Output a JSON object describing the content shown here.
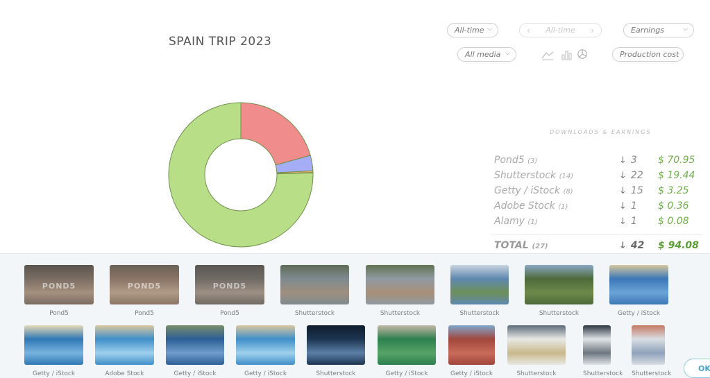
{
  "title": "SPAIN TRIP 2023",
  "filters": {
    "period": "All-time",
    "period_nav": "All-time",
    "metric": "Earnings",
    "media": "All media",
    "cost": "Production cost"
  },
  "summary_heading": "DOWNLOADS & EARNINGS",
  "rows": [
    {
      "name": "Pond5",
      "count": "(3)",
      "downloads": "3",
      "earnings": "$ 70.95"
    },
    {
      "name": "Shutterstock",
      "count": "(14)",
      "downloads": "22",
      "earnings": "$ 19.44"
    },
    {
      "name": "Getty / iStock",
      "count": "(8)",
      "downloads": "15",
      "earnings": "$ 3.25"
    },
    {
      "name": "Adobe Stock",
      "count": "(1)",
      "downloads": "1",
      "earnings": "$ 0.36"
    },
    {
      "name": "Alamy",
      "count": "(1)",
      "downloads": "1",
      "earnings": "$ 0.08"
    }
  ],
  "total": {
    "name": "TOTAL",
    "count": "(27)",
    "downloads": "42",
    "earnings": "$ 94.08"
  },
  "chart_data": {
    "type": "pie",
    "categories": [
      "Pond5",
      "Shutterstock",
      "Getty / iStock",
      "Adobe Stock",
      "Alamy"
    ],
    "values": [
      70.95,
      19.44,
      3.25,
      0.36,
      0.08
    ],
    "colors": [
      "#b9de88",
      "#f08c8c",
      "#a5adf7",
      "#f5b26b",
      "#8fd0e8"
    ]
  },
  "thumbs": [
    {
      "caption": "Pond5",
      "watermark": "POND5"
    },
    {
      "caption": "Pond5",
      "watermark": "POND5"
    },
    {
      "caption": "Pond5",
      "watermark": "POND5"
    },
    {
      "caption": "Shutterstock"
    },
    {
      "caption": "Shutterstock"
    },
    {
      "caption": "Shutterstock"
    },
    {
      "caption": "Shutterstock"
    },
    {
      "caption": "Getty / iStock"
    },
    {
      "caption": "Getty / iStock"
    },
    {
      "caption": "Adobe Stock"
    },
    {
      "caption": "Getty / iStock"
    },
    {
      "caption": "Getty / iStock"
    },
    {
      "caption": "Shutterstock"
    },
    {
      "caption": "Getty / iStock"
    },
    {
      "caption": "Getty / iStock"
    },
    {
      "caption": "Shutterstock"
    },
    {
      "caption": "Shutterstock"
    },
    {
      "caption": "Shutterstock"
    }
  ],
  "ok_label": "OK"
}
